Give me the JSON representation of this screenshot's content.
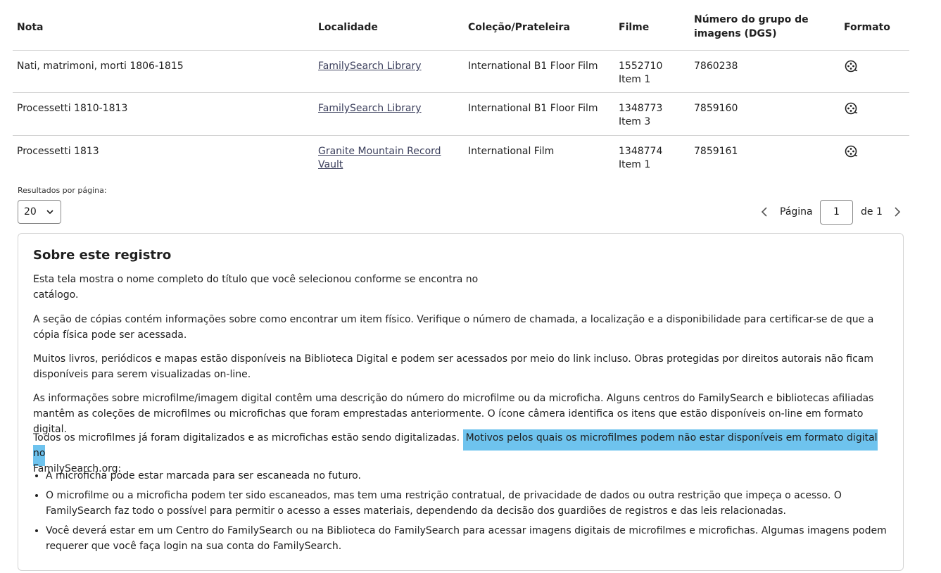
{
  "table": {
    "headers": {
      "nota": "Nota",
      "localidade": "Localidade",
      "colecao": "Coleção/Prateleira",
      "filme": "Filme",
      "dgs_line1": "Número do grupo de",
      "dgs_line2": "imagens (DGS)",
      "formato": "Formato"
    },
    "rows": [
      {
        "nota": "Nati, matrimoni, morti 1806-1815",
        "localidade_line1": "FamilySearch Library",
        "localidade_line2": "",
        "colecao": "International B1 Floor Film",
        "filme": "1552710",
        "item": "Item 1",
        "dgs": "7860238",
        "formato_icon": "film-reel-icon"
      },
      {
        "nota": "Processetti 1810-1813",
        "localidade_line1": "FamilySearch Library",
        "localidade_line2": "",
        "colecao": "International B1 Floor Film",
        "filme": "1348773",
        "item": "Item 3",
        "dgs": "7859160",
        "formato_icon": "film-reel-icon"
      },
      {
        "nota": "Processetti 1813",
        "localidade_line1": "Granite Mountain Record",
        "localidade_line2": "Vault",
        "colecao": "International Film",
        "filme": "1348774",
        "item": "Item 1",
        "dgs": "7859161",
        "formato_icon": "film-reel-icon"
      }
    ]
  },
  "pagination": {
    "per_page_label": "Resultados por página:",
    "per_page_value": "20",
    "page_label": "Página",
    "page_value": "1",
    "of_label": "de 1"
  },
  "about": {
    "title": "Sobre este registro",
    "p1_line1": "Esta tela mostra o nome completo do título que você selecionou conforme se encontra no",
    "p1_line2": "catálogo.",
    "p2": "A seção de cópias contém informações sobre como encontrar um item físico. Verifique o número de chamada, a localização e a disponibilidade para certificar-se de que a cópia física pode ser acessada.",
    "p3": "Muitos livros, periódicos e mapas estão disponíveis na Biblioteca Digital e podem ser acessados por meio do link incluso. Obras protegidas por direitos autorais não ficam disponíveis para serem visualizadas on-line.",
    "p4": "As informações sobre microfilme/imagem digital contêm uma descrição do número do microfilme ou da microficha. Alguns centros do FamilySearch e bibliotecas afiliadas mantêm as coleções de microfilmes ou microfichas que foram emprestadas anteriormente. O ícone câmera identifica os itens que estão disponíveis on-line em formato digital.",
    "p5_start": "Todos os microfilmes já foram digitalizados e as microfichas estão sendo digitalizadas.",
    "p5_highlight": "Motivos pelos quais os microfilmes podem não estar disponíveis em formato digital no",
    "p5_end": "FamilySearch.org:",
    "bullets": [
      "A microficha pode estar marcada para ser escaneada no futuro.",
      "O microfilme ou a microficha podem ter sido escaneados, mas tem uma restrição contratual, de privacidade de dados ou outra restrição que impeça o acesso. O FamilySearch faz todo o possível para permitir o acesso a esses materiais, dependendo da decisão dos guardiões de registros e das leis relacionadas.",
      "Você deverá estar em um Centro do FamilySearch ou na Biblioteca do FamilySearch para acessar imagens digitais de microfilmes e microfichas. Algumas imagens podem requerer que você faça login na sua conta do FamilySearch."
    ]
  },
  "colors": {
    "highlight": "#6ec3ee",
    "link": "#3b3f5c",
    "border": "#d4d4d4"
  }
}
